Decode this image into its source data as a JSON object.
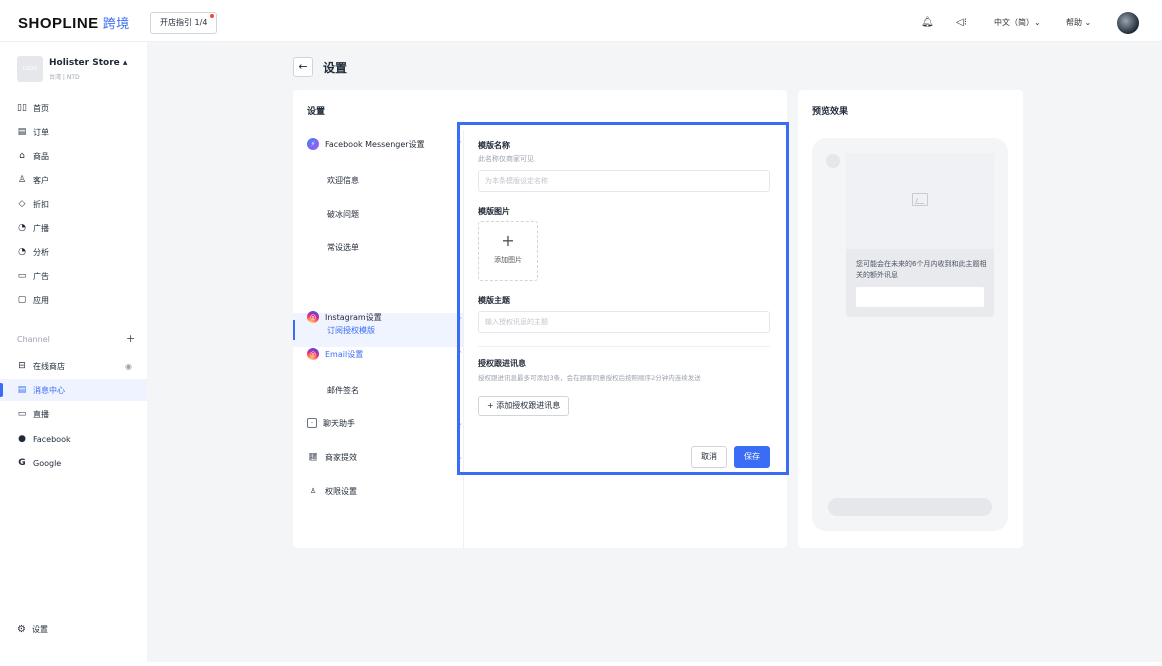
{
  "header": {
    "logo_text": "SHOPLINE",
    "logo_cn": "跨境",
    "guide_label": "开店指引 1/4",
    "language": "中文（简）⌄",
    "help": "帮助 ⌄"
  },
  "sidebar": {
    "store_logo": "LOGO",
    "store_name": "Holister Store ▴",
    "store_sub": "台湾 | NTD",
    "items": [
      {
        "icon": "▯▯",
        "label": "首页"
      },
      {
        "icon": "▤",
        "label": "订单"
      },
      {
        "icon": "⌂",
        "label": "商品"
      },
      {
        "icon": "♙",
        "label": "客户"
      },
      {
        "icon": "◇",
        "label": "折扣"
      },
      {
        "icon": "◔",
        "label": "广播"
      },
      {
        "icon": "◔",
        "label": "分析"
      },
      {
        "icon": "▭",
        "label": "广告"
      },
      {
        "icon": "▢",
        "label": "应用"
      }
    ],
    "channel_label": "Channel",
    "channel_plus": "+",
    "channels": [
      {
        "icon": "⊟",
        "label": "在线商店"
      },
      {
        "icon": "▤",
        "label": "消息中心"
      },
      {
        "icon": "▭",
        "label": "直播"
      },
      {
        "icon": "●",
        "label": "Facebook"
      },
      {
        "icon": "G",
        "label": "Google"
      }
    ],
    "settings_label": "设置"
  },
  "page": {
    "back": "←",
    "title": "设置"
  },
  "settings_card": {
    "title": "设置",
    "menu": {
      "messenger": "Facebook Messenger设置",
      "messenger_sub": [
        "欢迎信息",
        "破冰问题",
        "常设选单",
        "订阅授权模版"
      ],
      "instagram": "Instagram设置",
      "email": "Email设置",
      "email_sub": [
        "邮件签名"
      ],
      "chat": "聊天助手",
      "merchant": "商家提效",
      "permission": "权限设置"
    }
  },
  "form": {
    "name_label": "模版名称",
    "name_hint": "此名称仅商家可见",
    "name_placeholder": "为本条模版设定名称",
    "image_label": "模版图片",
    "upload_plus": "+",
    "upload_text": "添加图片",
    "topic_label": "模版主题",
    "topic_placeholder": "输入授权讯息的主题",
    "follow_label": "授权跟进讯息",
    "follow_hint": "授权跟进讯息最多可添加3条，会在顾客同意授权后按照顺序2分钟内连续发送",
    "add_follow": "+ 添加授权跟进讯息",
    "cancel": "取消",
    "save": "保存"
  },
  "preview": {
    "title": "预览效果",
    "message": "您可能会在未来的6个月内收到和此主题相关的额外讯息"
  },
  "colors": {
    "accent": "#3b6cf6",
    "highlight_border": "#3b6cf6"
  }
}
